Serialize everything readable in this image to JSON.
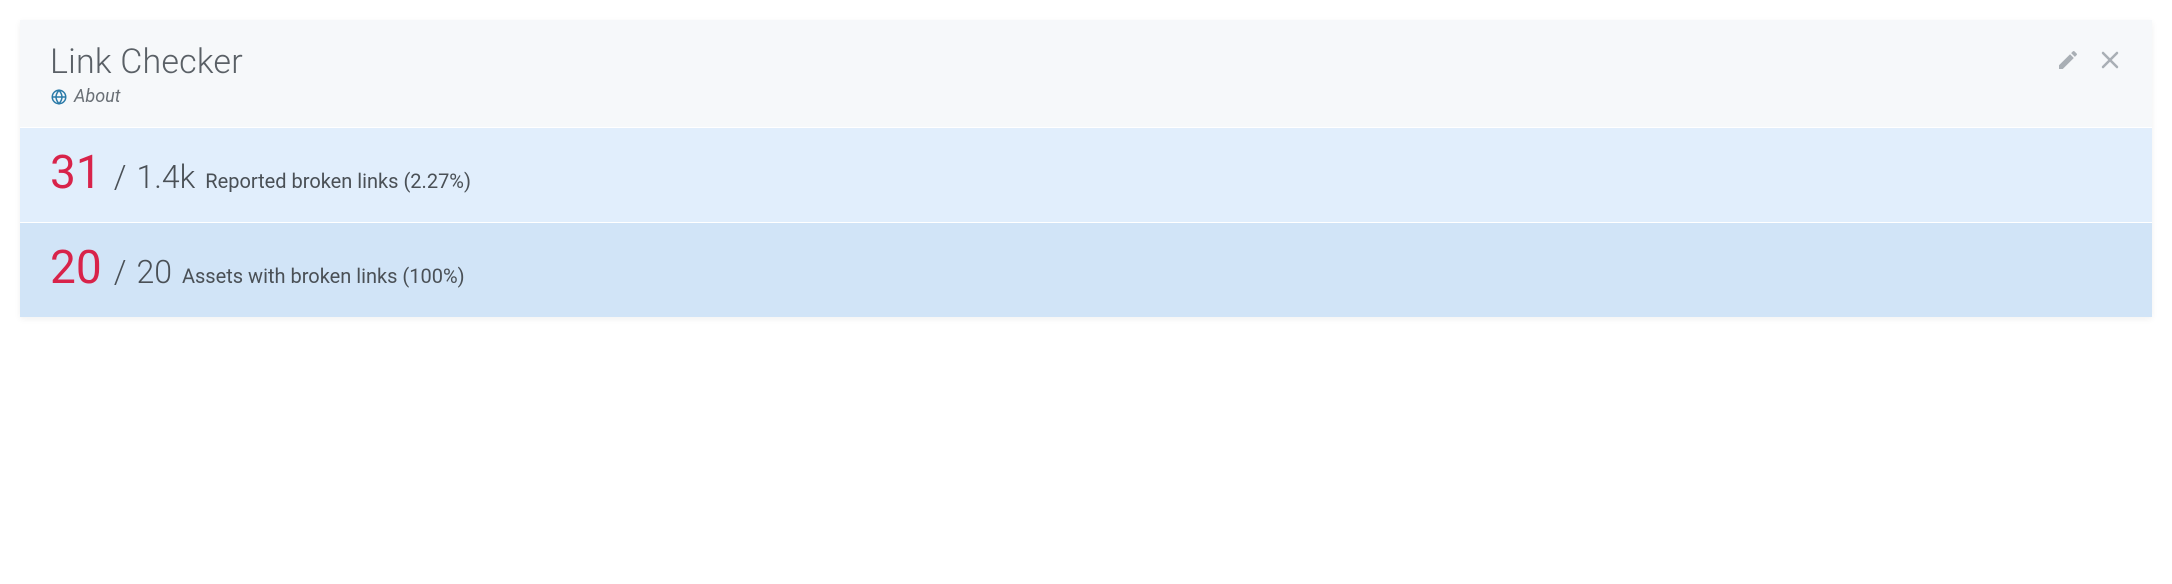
{
  "header": {
    "title": "Link Checker",
    "about_label": "About"
  },
  "stats": [
    {
      "count": "31",
      "separator": "/",
      "total": "1.4k",
      "label": "Reported broken links (2.27%)"
    },
    {
      "count": "20",
      "separator": "/",
      "total": "20",
      "label": "Assets with broken links (100%)"
    }
  ]
}
